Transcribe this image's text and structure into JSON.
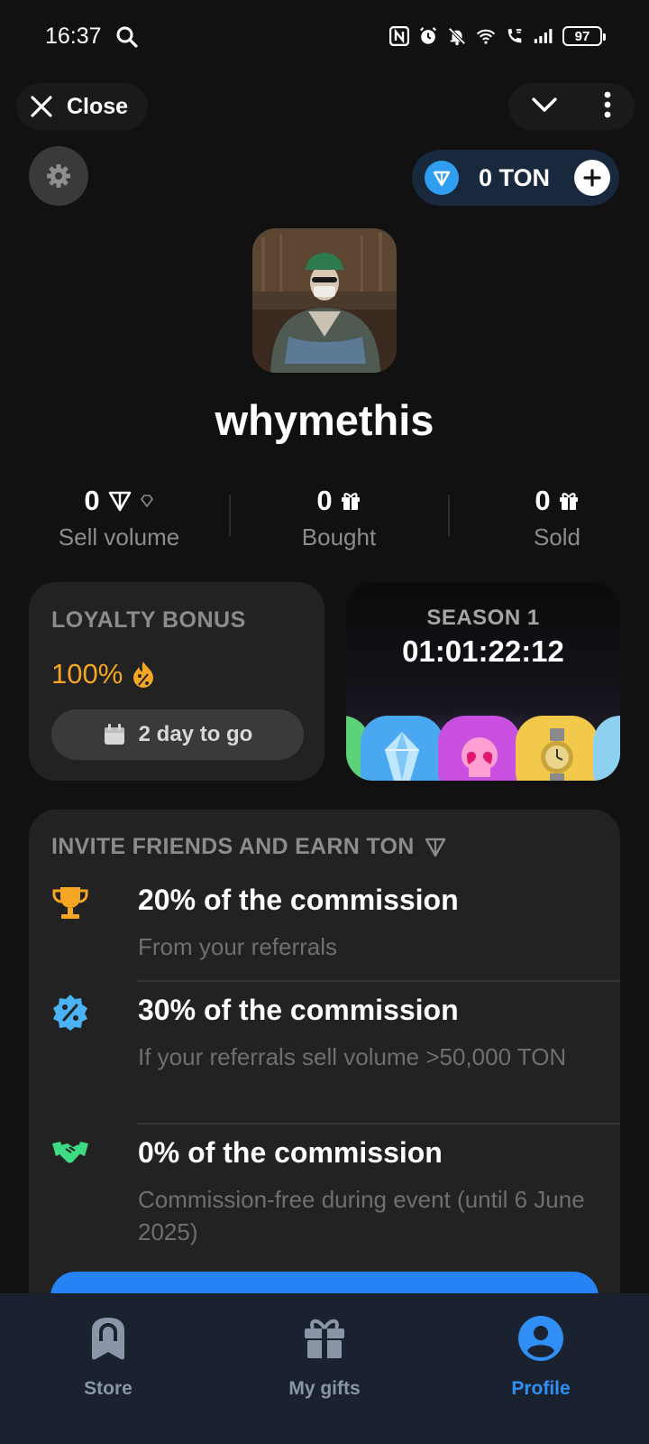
{
  "status_bar": {
    "time": "16:37",
    "battery": "97",
    "icons": [
      "search-icon",
      "nfc-icon",
      "alarm-icon",
      "bell-off-icon",
      "wifi-icon",
      "wifi-call-icon",
      "signal-icon",
      "battery-icon"
    ]
  },
  "header": {
    "close_label": "Close",
    "menu_icons": [
      "chevron-down-icon",
      "more-vertical-icon"
    ]
  },
  "wallet": {
    "balance_label": "0 TON",
    "accent": "#2f9ef0"
  },
  "profile": {
    "username": "whymethis"
  },
  "stats": [
    {
      "value": "0",
      "label": "Sell volume",
      "icon": "ton-icon"
    },
    {
      "value": "0",
      "label": "Bought",
      "icon": "gift-icon"
    },
    {
      "value": "0",
      "label": "Sold",
      "icon": "gift-icon"
    }
  ],
  "loyalty": {
    "title": "LOYALTY BONUS",
    "percent": "100%",
    "countdown": "2 day to go",
    "accent": "#f5a623"
  },
  "season": {
    "title": "SEASON 1",
    "timer": "01:01:22:12"
  },
  "invite": {
    "title": "INVITE FRIENDS AND EARN TON",
    "items": [
      {
        "title": "20% of the commission",
        "subtitle": "From your referrals",
        "icon": "trophy-icon"
      },
      {
        "title": "30% of the commission",
        "subtitle": "If your referrals sell volume >50,000 TON",
        "icon": "percent-badge-icon"
      },
      {
        "title": "0% of the commission",
        "subtitle": "Commission-free during event (until 6 June 2025)",
        "icon": "handshake-icon"
      }
    ]
  },
  "tabbar": {
    "tabs": [
      {
        "label": "Store",
        "icon": "store-icon",
        "active": false
      },
      {
        "label": "My gifts",
        "icon": "gift-icon",
        "active": false
      },
      {
        "label": "Profile",
        "icon": "profile-icon",
        "active": true
      }
    ],
    "active_color": "#2f8ff5"
  }
}
